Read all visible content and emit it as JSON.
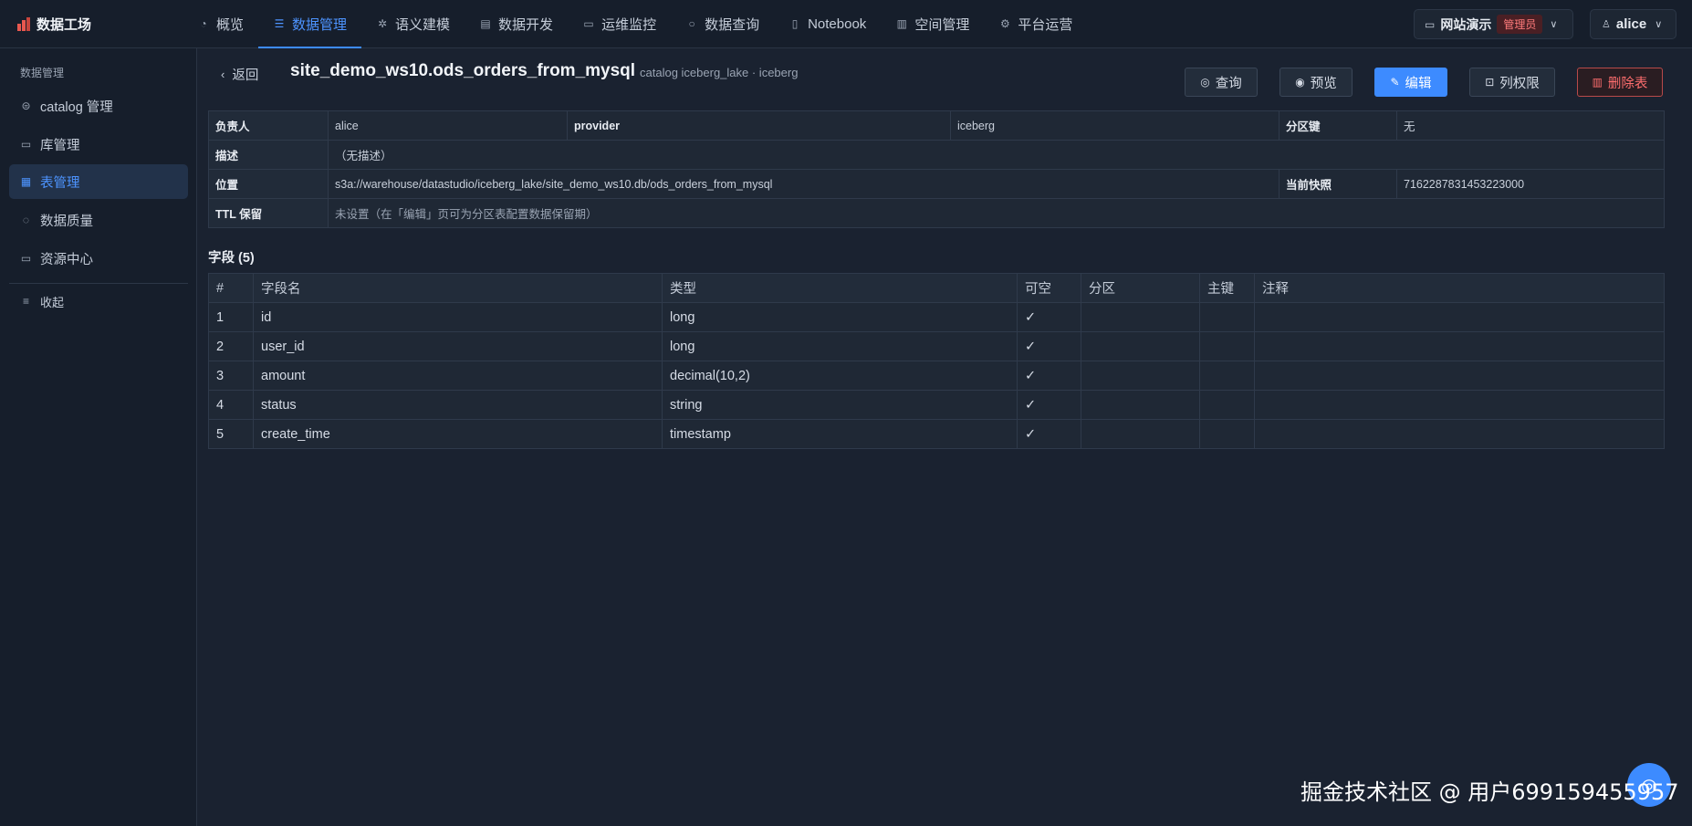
{
  "brand": {
    "title": "数据工场"
  },
  "nav": {
    "items": [
      {
        "label": "概览",
        "icon": "gauge-icon"
      },
      {
        "label": "数据管理",
        "icon": "database-icon"
      },
      {
        "label": "语义建模",
        "icon": "sparkles-icon"
      },
      {
        "label": "数据开发",
        "icon": "code-icon"
      },
      {
        "label": "运维监控",
        "icon": "monitor-icon"
      },
      {
        "label": "数据查询",
        "icon": "search-icon"
      },
      {
        "label": "Notebook",
        "icon": "notebook-icon"
      },
      {
        "label": "空间管理",
        "icon": "building-icon"
      },
      {
        "label": "平台运营",
        "icon": "gear-icon"
      }
    ]
  },
  "workspace": {
    "name": "网站演示",
    "role": "管理员"
  },
  "user": {
    "name": "alice"
  },
  "sidebar": {
    "section": "数据管理",
    "items": [
      {
        "label": "catalog 管理",
        "icon": "catalog-icon"
      },
      {
        "label": "库管理",
        "icon": "folder-icon"
      },
      {
        "label": "表管理",
        "icon": "table-icon"
      },
      {
        "label": "数据质量",
        "icon": "check-circle-icon"
      },
      {
        "label": "资源中心",
        "icon": "briefcase-icon"
      }
    ],
    "collapse": "收起"
  },
  "header": {
    "back": "返回",
    "table_name": "site_demo_ws10.ods_orders_from_mysql",
    "catalog_info": "catalog iceberg_lake · iceberg",
    "buttons": {
      "query": "查询",
      "preview": "预览",
      "edit": "编辑",
      "permissions": "列权限",
      "delete": "删除表"
    }
  },
  "info": {
    "owner_label": "负责人",
    "owner": "alice",
    "provider_label": "provider",
    "provider": "iceberg",
    "partition_label": "分区键",
    "partition": "无",
    "desc_label": "描述",
    "desc": "（无描述）",
    "location_label": "位置",
    "location": "s3a://warehouse/datastudio/iceberg_lake/site_demo_ws10.db/ods_orders_from_mysql",
    "snapshot_label": "当前快照",
    "snapshot": "7162287831453223000",
    "ttl_label": "TTL 保留",
    "ttl": "未设置（在「编辑」页可为分区表配置数据保留期）"
  },
  "fields": {
    "title": "字段 (5)",
    "columns": [
      "#",
      "字段名",
      "类型",
      "可空",
      "分区",
      "主键",
      "注释"
    ],
    "rows": [
      {
        "no": "1",
        "name": "id",
        "type": "long",
        "nullable": "✓",
        "partition": "",
        "pk": "",
        "comment": ""
      },
      {
        "no": "2",
        "name": "user_id",
        "type": "long",
        "nullable": "✓",
        "partition": "",
        "pk": "",
        "comment": ""
      },
      {
        "no": "3",
        "name": "amount",
        "type": "decimal(10,2)",
        "nullable": "✓",
        "partition": "",
        "pk": "",
        "comment": ""
      },
      {
        "no": "4",
        "name": "status",
        "type": "string",
        "nullable": "✓",
        "partition": "",
        "pk": "",
        "comment": ""
      },
      {
        "no": "5",
        "name": "create_time",
        "type": "timestamp",
        "nullable": "✓",
        "partition": "",
        "pk": "",
        "comment": ""
      }
    ]
  },
  "watermark": "掘金技术社区 @ 用户699159455957",
  "colors": {
    "accent": "#3d8bff",
    "danger": "#ff6e6e",
    "background": "#1a2230"
  }
}
